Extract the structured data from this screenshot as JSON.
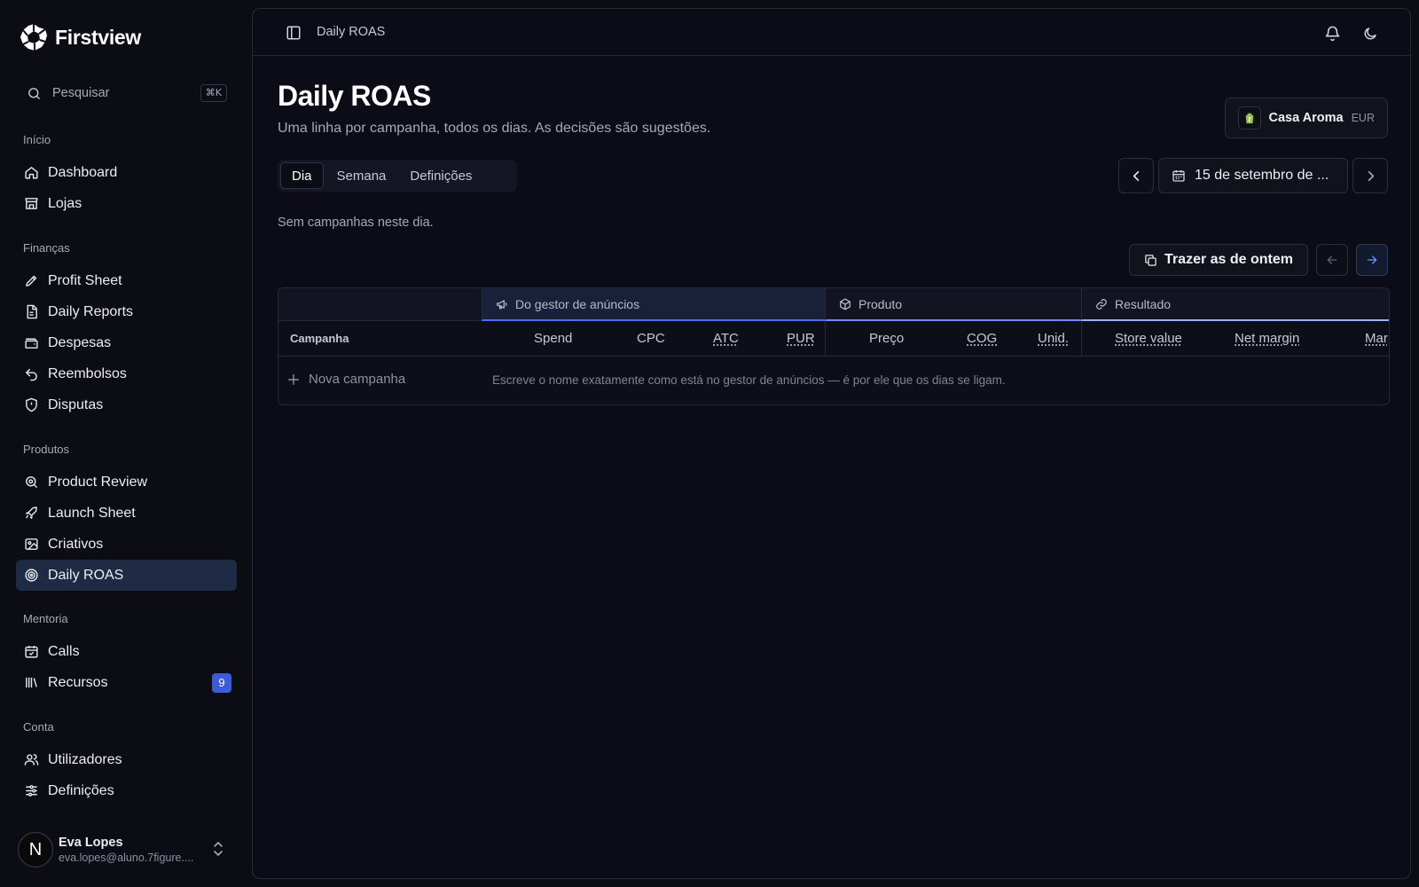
{
  "brand": {
    "name": "Firstview"
  },
  "search": {
    "label": "Pesquisar",
    "shortcut": "⌘K"
  },
  "sidebar": {
    "sections": [
      {
        "title": "Início",
        "items": [
          {
            "label": "Dashboard",
            "icon": "home-icon"
          },
          {
            "label": "Lojas",
            "icon": "store-icon"
          }
        ]
      },
      {
        "title": "Finanças",
        "items": [
          {
            "label": "Profit Sheet",
            "icon": "pencil-icon"
          },
          {
            "label": "Daily Reports",
            "icon": "file-text-icon"
          },
          {
            "label": "Despesas",
            "icon": "wallet-icon"
          },
          {
            "label": "Reembolsos",
            "icon": "undo-icon"
          },
          {
            "label": "Disputas",
            "icon": "shield-icon"
          }
        ]
      },
      {
        "title": "Produtos",
        "items": [
          {
            "label": "Product Review",
            "icon": "search-zoom-icon"
          },
          {
            "label": "Launch Sheet",
            "icon": "rocket-icon"
          },
          {
            "label": "Criativos",
            "icon": "image-icon"
          },
          {
            "label": "Daily ROAS",
            "icon": "target-icon",
            "active": true
          }
        ]
      },
      {
        "title": "Mentoria",
        "items": [
          {
            "label": "Calls",
            "icon": "calendar-icon"
          },
          {
            "label": "Recursos",
            "icon": "library-icon",
            "badge": "9"
          }
        ]
      },
      {
        "title": "Conta",
        "items": [
          {
            "label": "Utilizadores",
            "icon": "users-icon"
          },
          {
            "label": "Definições",
            "icon": "sliders-icon"
          }
        ]
      }
    ]
  },
  "user": {
    "initial": "N",
    "name": "Eva Lopes",
    "email": "eva.lopes@aluno.7figure...."
  },
  "topbar": {
    "breadcrumb": "Daily ROAS"
  },
  "page": {
    "title": "Daily ROAS",
    "subtitle": "Uma linha por campanha, todos os dias. As decisões são sugestões.",
    "store": {
      "name": "Casa Aroma",
      "currency": "EUR"
    },
    "tabs": [
      "Dia",
      "Semana",
      "Definições"
    ],
    "date": "15 de setembro de ...",
    "empty_message": "Sem campanhas neste dia.",
    "bring_button": "Trazer as de ontem"
  },
  "table": {
    "groups": {
      "ads": "Do gestor de anúncios",
      "product": "Produto",
      "result": "Resultado"
    },
    "columns": {
      "campaign": "Campanha",
      "spend": "Spend",
      "cpc": "CPC",
      "atc": "ATC",
      "pur": "PUR",
      "price": "Preço",
      "cog": "COG",
      "units": "Unid.",
      "store_value": "Store value",
      "net_margin": "Net margin",
      "margin_cut": "Mar"
    },
    "new_campaign": "Nova campanha",
    "hint": "Escreve o nome exatamente como está no gestor de anúncios — é por ele que os dias se ligam."
  },
  "colors": {
    "accent": "#4c6ef5",
    "active_nav": "#1f2a44",
    "badge": "#3b5bdb"
  }
}
